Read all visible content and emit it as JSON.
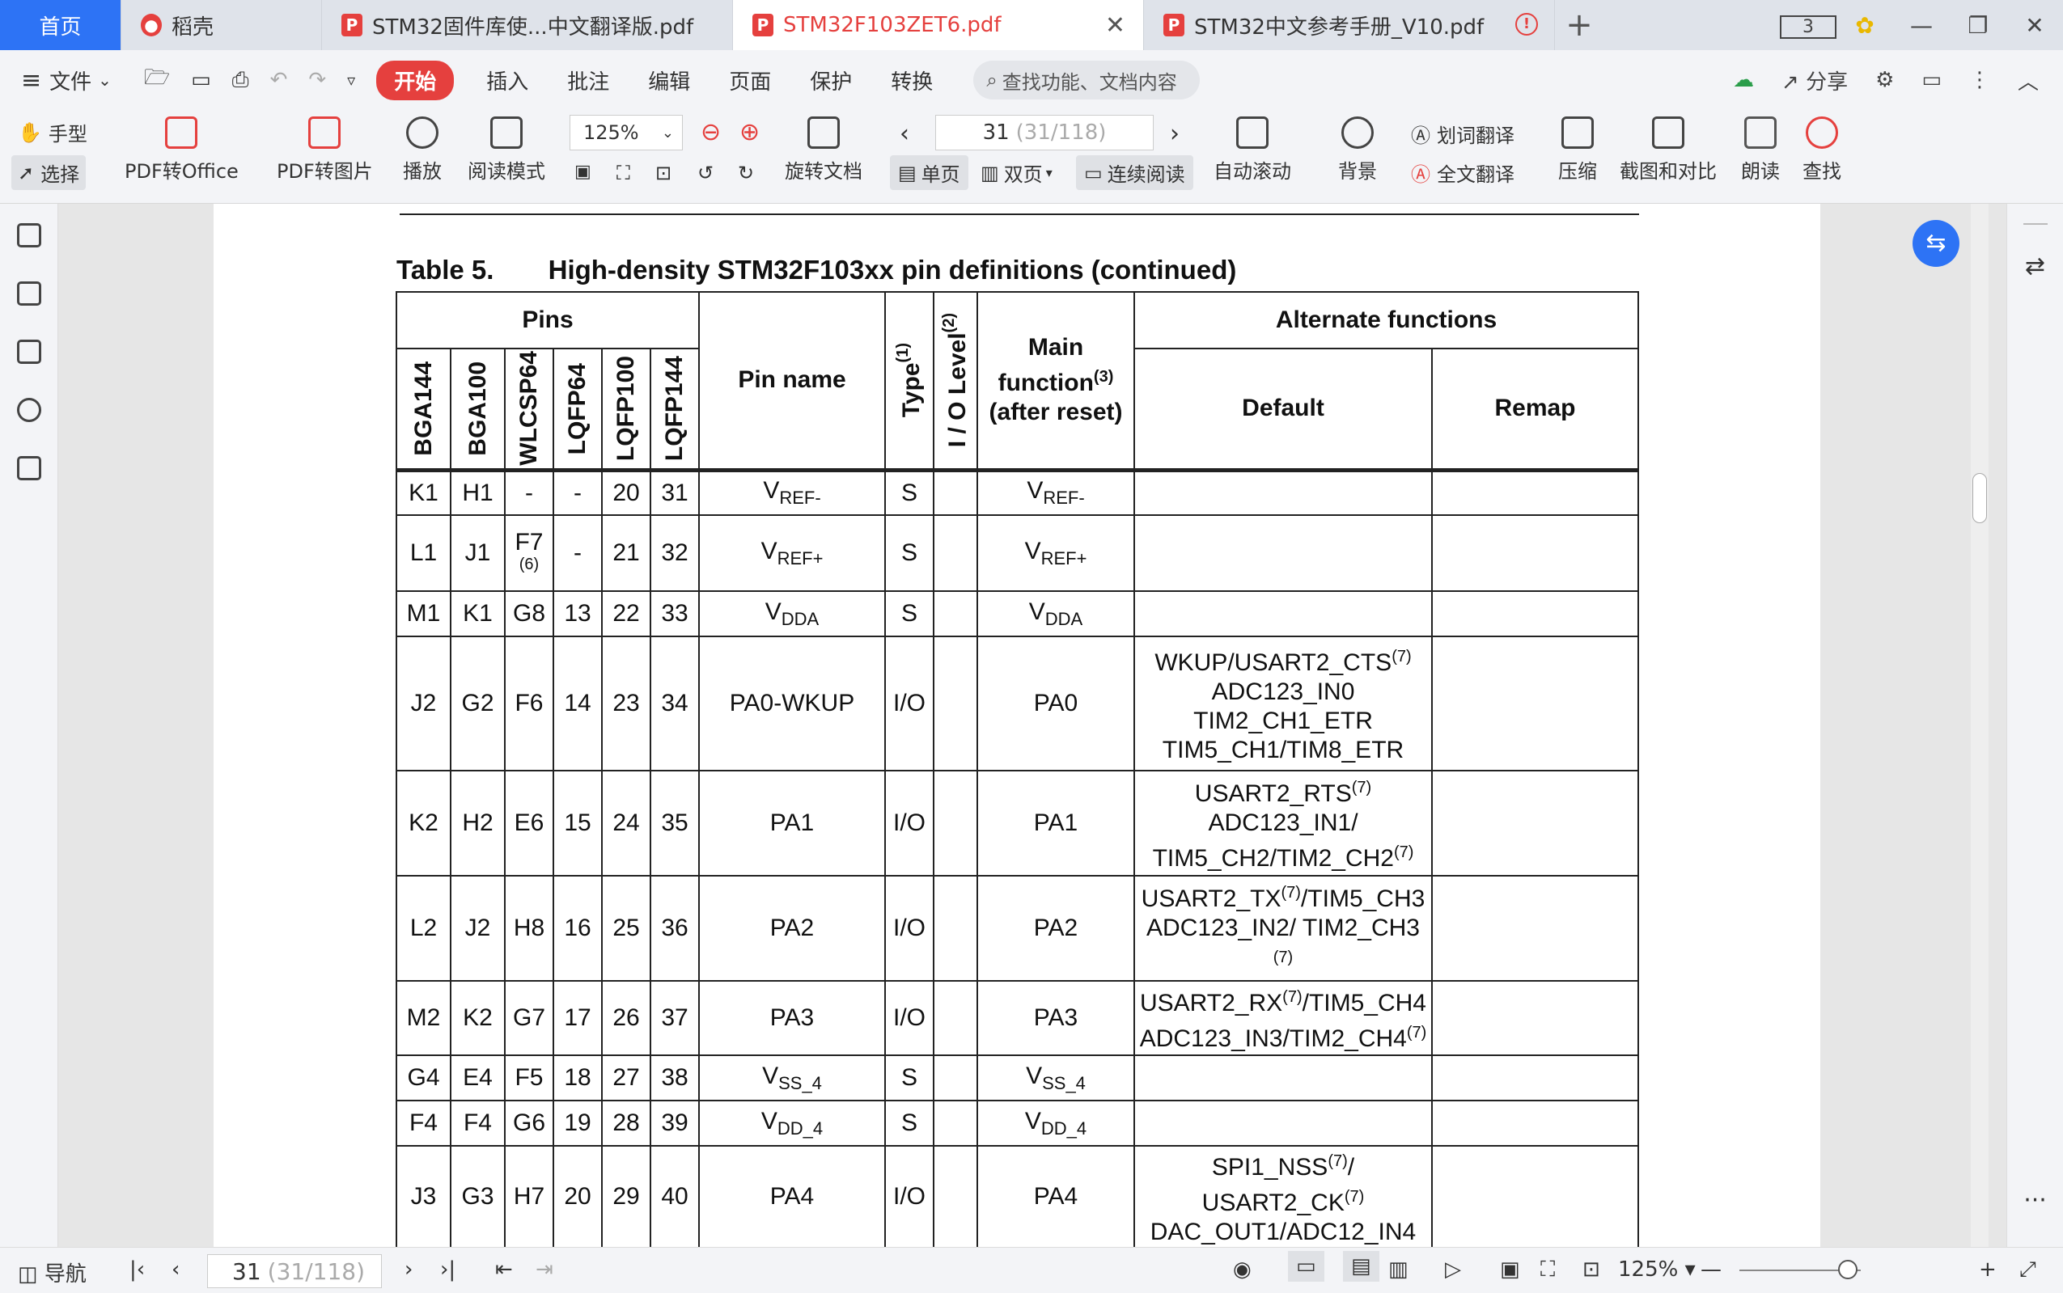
{
  "tabs": {
    "home": "首页",
    "docer": "稻壳",
    "t1": "STM32固件库使...中文翻译版.pdf",
    "t2": "STM32F103ZET6.pdf",
    "t3": "STM32中文参考手册_V10.pdf",
    "count": "3"
  },
  "menu": {
    "file": "文件",
    "items": [
      "开始",
      "插入",
      "批注",
      "编辑",
      "页面",
      "保护",
      "转换"
    ],
    "search": "查找功能、文档内容",
    "share": "分享"
  },
  "ribbon": {
    "hand": "手型",
    "select": "选择",
    "pdf_office": "PDF转Office",
    "pdf_image": "PDF转图片",
    "play": "播放",
    "read_mode": "阅读模式",
    "zoom": "125%",
    "rotate": "旋转文档",
    "page_input": "31",
    "page_total": "(31/118)",
    "single": "单页",
    "double": "双页",
    "continuous": "连续阅读",
    "autoscroll": "自动滚动",
    "background": "背景",
    "word_translate": "划词翻译",
    "full_translate": "全文翻译",
    "compress": "压缩",
    "screenshot": "截图和对比",
    "read_aloud": "朗读",
    "find": "查找"
  },
  "document": {
    "caption_label": "Table 5.",
    "caption_title": "High-density STM32F103xx pin definitions (continued)",
    "headers": {
      "pins": "Pins",
      "cols": [
        "BGA144",
        "BGA100",
        "WLCSP64",
        "LQFP64",
        "LQFP100",
        "LQFP144"
      ],
      "pin_name": "Pin name",
      "type": "Type",
      "type_sup": "(1)",
      "io_level": "I / O Level",
      "io_sup": "(2)",
      "main_function": "Main function",
      "main_sup": "(3)",
      "after_reset": "(after reset)",
      "alternate": "Alternate functions",
      "default": "Default",
      "remap": "Remap"
    },
    "rows": [
      {
        "c": [
          "K1",
          "H1",
          "-",
          "-",
          "20",
          "31"
        ],
        "name": "V",
        "name_sub": "REF-",
        "type": "S",
        "main": "V",
        "main_sub": "REF-",
        "default": ""
      },
      {
        "c": [
          "L1",
          "J1",
          "F7",
          "-",
          "21",
          "32"
        ],
        "c_note": "(6)",
        "name": "V",
        "name_sub": "REF+",
        "type": "S",
        "main": "V",
        "main_sub": "REF+",
        "default": ""
      },
      {
        "c": [
          "M1",
          "K1",
          "G8",
          "13",
          "22",
          "33"
        ],
        "name": "V",
        "name_sub": "DDA",
        "type": "S",
        "main": "V",
        "main_sub": "DDA",
        "default": ""
      },
      {
        "c": [
          "J2",
          "G2",
          "F6",
          "14",
          "23",
          "34"
        ],
        "name": "PA0-WKUP",
        "type": "I/O",
        "main": "PA0",
        "default": "WKUP/USART2_CTS(7) ADC123_IN0 TIM2_CH1_ETR TIM5_CH1/TIM8_ETR"
      },
      {
        "c": [
          "K2",
          "H2",
          "E6",
          "15",
          "24",
          "35"
        ],
        "name": "PA1",
        "type": "I/O",
        "main": "PA1",
        "default": "USART2_RTS(7) ADC123_IN1/ TIM5_CH2/TIM2_CH2(7)"
      },
      {
        "c": [
          "L2",
          "J2",
          "H8",
          "16",
          "25",
          "36"
        ],
        "name": "PA2",
        "type": "I/O",
        "main": "PA2",
        "default": "USART2_TX(7)/TIM5_CH3 ADC123_IN2/ TIM2_CH3 (7)"
      },
      {
        "c": [
          "M2",
          "K2",
          "G7",
          "17",
          "26",
          "37"
        ],
        "name": "PA3",
        "type": "I/O",
        "main": "PA3",
        "default": "USART2_RX(7)/TIM5_CH4 ADC123_IN3/TIM2_CH4(7)"
      },
      {
        "c": [
          "G4",
          "E4",
          "F5",
          "18",
          "27",
          "38"
        ],
        "name": "V",
        "name_sub": "SS_4",
        "type": "S",
        "main": "V",
        "main_sub": "SS_4",
        "default": ""
      },
      {
        "c": [
          "F4",
          "F4",
          "G6",
          "19",
          "28",
          "39"
        ],
        "name": "V",
        "name_sub": "DD_4",
        "type": "S",
        "main": "V",
        "main_sub": "DD_4",
        "default": ""
      },
      {
        "c": [
          "J3",
          "G3",
          "H7",
          "20",
          "29",
          "40"
        ],
        "name": "PA4",
        "type": "I/O",
        "main": "PA4",
        "default": "SPI1_NSS(7)/ USART2_CK(7) DAC_OUT1/ADC12_IN4"
      }
    ]
  },
  "status": {
    "nav": "导航",
    "page_input": "31",
    "page_total": "(31/118)",
    "zoom": "125%"
  }
}
